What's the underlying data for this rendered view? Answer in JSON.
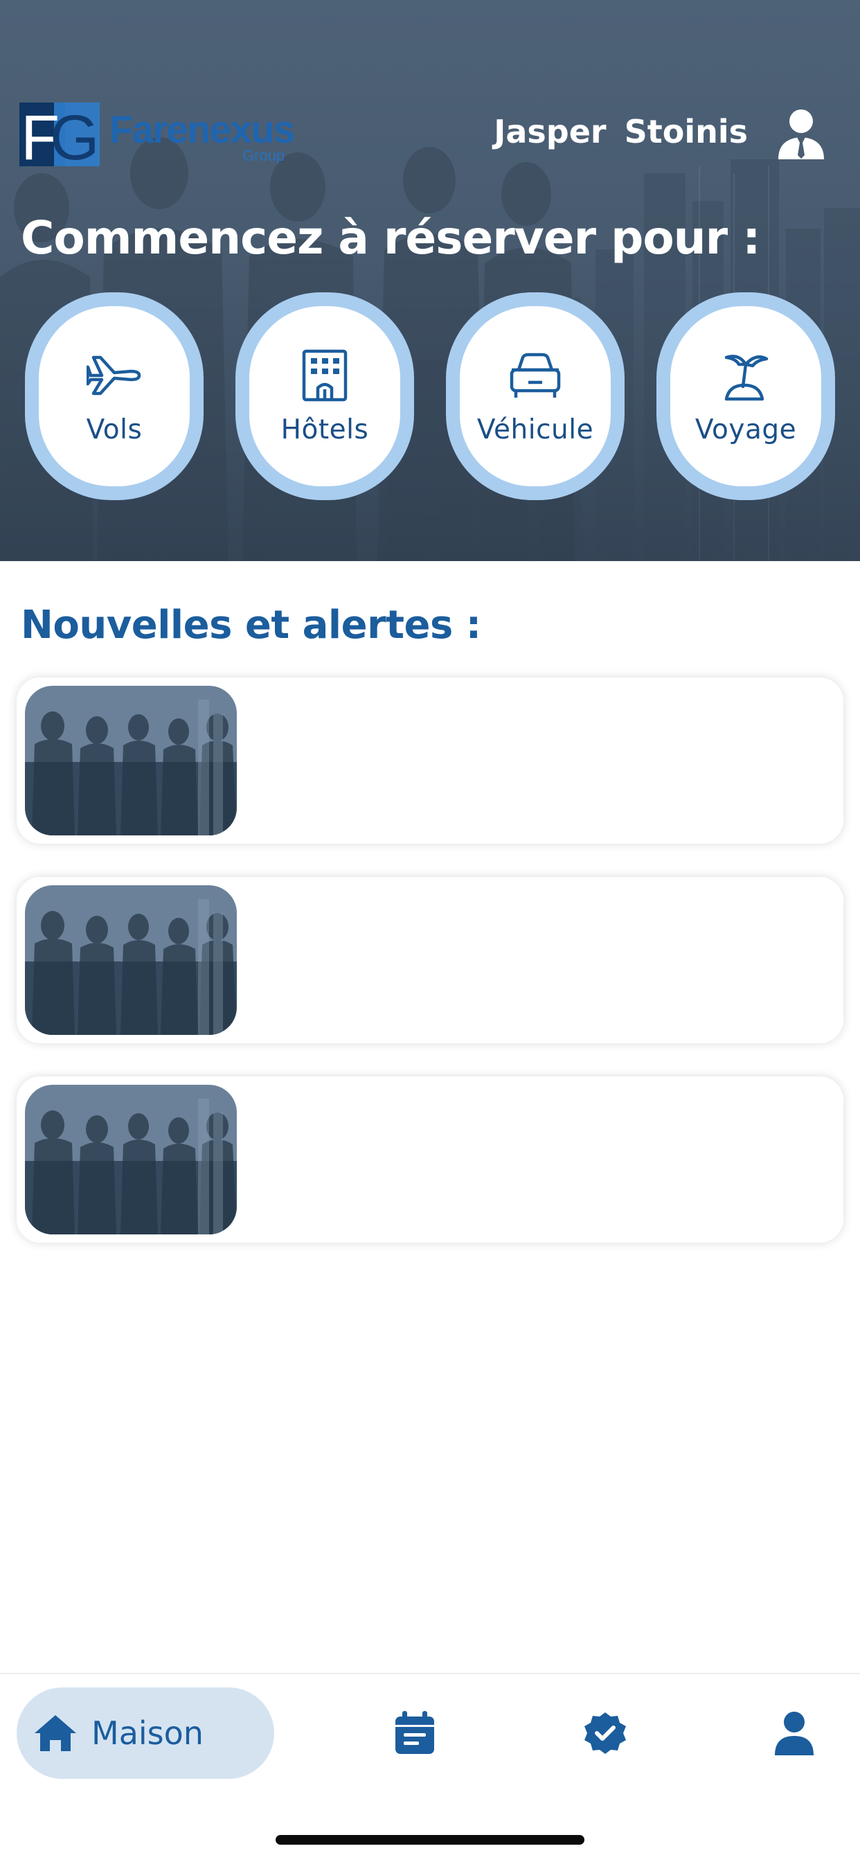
{
  "brand": {
    "name": "Farenexus",
    "sub": "Group",
    "mark_letters": "FG"
  },
  "user": {
    "name": "Jasper  Stoinis",
    "icon": "user-tie-icon"
  },
  "hero": {
    "title": "Commencez à réserver pour :",
    "categories": [
      {
        "label": "Vols",
        "icon": "plane-icon"
      },
      {
        "label": "Hôtels",
        "icon": "hotel-icon"
      },
      {
        "label": "Véhicule",
        "icon": "car-icon"
      },
      {
        "label": "Voyage",
        "icon": "palm-island-icon"
      }
    ]
  },
  "news": {
    "title": "Nouvelles et alertes :",
    "items": [
      {
        "image": "business-team-image"
      },
      {
        "image": "business-team-image"
      },
      {
        "image": "business-team-image"
      }
    ]
  },
  "nav": {
    "items": [
      {
        "label": "Maison",
        "icon": "home-icon",
        "active": true
      },
      {
        "label": "",
        "icon": "calendar-icon",
        "active": false
      },
      {
        "label": "",
        "icon": "verified-badge-icon",
        "active": false
      },
      {
        "label": "",
        "icon": "profile-icon",
        "active": false
      }
    ]
  },
  "colors": {
    "primary": "#1b5d9d",
    "category_ring": "#a9cdef",
    "nav_active_bg": "#d5e3f1",
    "hero_overlay": "#4a5d72"
  }
}
